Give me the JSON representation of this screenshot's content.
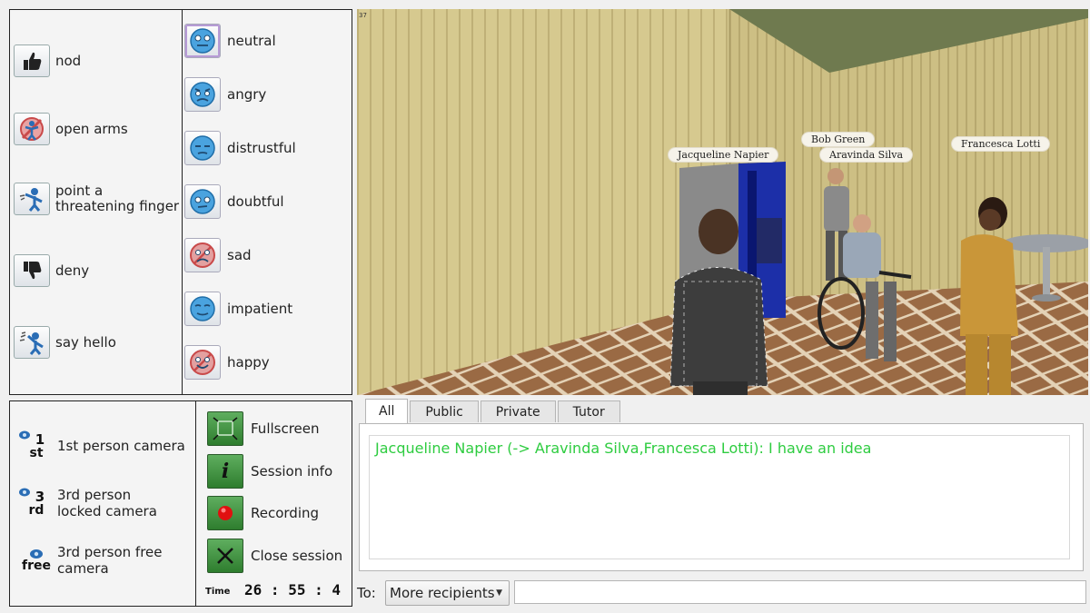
{
  "gestures": [
    {
      "label": "nod",
      "icon": "thumbs-up-icon"
    },
    {
      "label": "open arms",
      "icon": "open-arms-icon"
    },
    {
      "label": "point a threatening finger",
      "icon": "pointing-finger-icon"
    },
    {
      "label": "deny",
      "icon": "thumbs-down-icon"
    },
    {
      "label": "say hello",
      "icon": "waving-hand-icon"
    }
  ],
  "emotions": [
    {
      "label": "neutral",
      "icon": "neutral-face-icon",
      "color": "#4aa3df"
    },
    {
      "label": "angry",
      "icon": "angry-face-icon",
      "color": "#4aa3df"
    },
    {
      "label": "distrustful",
      "icon": "distrustful-face-icon",
      "color": "#4aa3df"
    },
    {
      "label": "doubtful",
      "icon": "doubtful-face-icon",
      "color": "#4aa3df"
    },
    {
      "label": "sad",
      "icon": "sad-face-icon",
      "color": "#d95b5b"
    },
    {
      "label": "impatient",
      "icon": "impatient-face-icon",
      "color": "#4aa3df"
    },
    {
      "label": "happy",
      "icon": "happy-face-icon",
      "color": "#d95b5b"
    }
  ],
  "cameras": [
    {
      "label": "1st person camera",
      "num": "1",
      "sub": "st",
      "icon": "first-person-camera-icon"
    },
    {
      "label": "3rd person locked camera",
      "num": "3",
      "sub": "rd",
      "icon": "third-person-locked-camera-icon"
    },
    {
      "label": "3rd person free camera",
      "num": "",
      "sub": "free",
      "icon": "third-person-free-camera-icon"
    }
  ],
  "controls": [
    {
      "label": "Fullscreen",
      "icon": "fullscreen-icon"
    },
    {
      "label": "Session info",
      "icon": "info-icon"
    },
    {
      "label": "Recording",
      "icon": "record-icon"
    },
    {
      "label": "Close session",
      "icon": "close-icon"
    }
  ],
  "session": {
    "time_label": "Time",
    "time_value": "26 : 55 : 4"
  },
  "scene": {
    "corner_text": "37",
    "avatars": [
      {
        "name": "Jacqueline Napier"
      },
      {
        "name": "Bob Green"
      },
      {
        "name": "Aravinda Silva"
      },
      {
        "name": "Francesca Lotti"
      }
    ]
  },
  "chat": {
    "tabs": [
      "All",
      "Public",
      "Private",
      "Tutor"
    ],
    "active_tab": "All",
    "message": "Jacqueline Napier (-> Aravinda Silva,Francesca Lotti): I have an idea",
    "message_color": "#2ecc40"
  },
  "compose": {
    "to_label": "To:",
    "recipients_label": "More recipients",
    "input_value": ""
  }
}
